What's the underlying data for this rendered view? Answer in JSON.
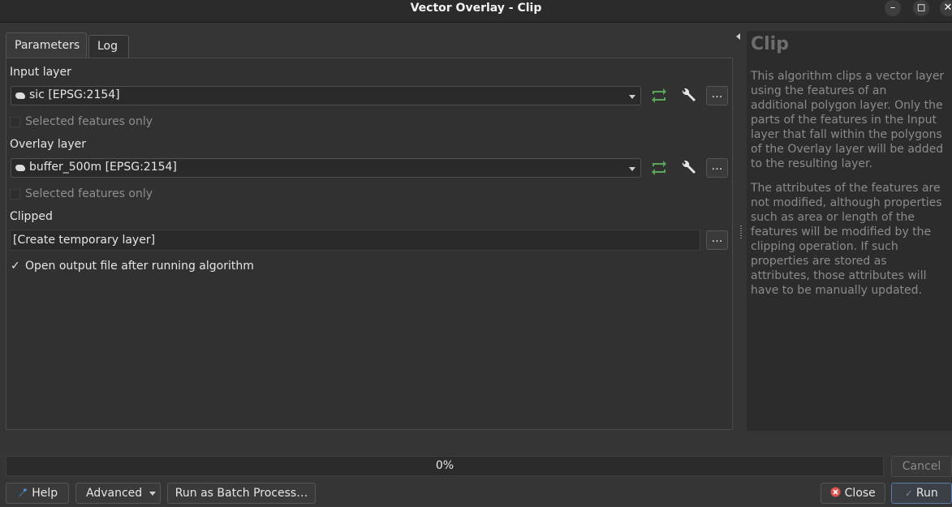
{
  "window": {
    "title": "Vector Overlay - Clip",
    "minimize": "–",
    "maximize": "◻",
    "close": "✕"
  },
  "tabs": [
    {
      "label": "Parameters",
      "active": true
    },
    {
      "label": "Log",
      "active": false
    }
  ],
  "params": {
    "input_layer": {
      "label": "Input layer",
      "value": "sic [EPSG:2154]",
      "selected_only_label": "Selected features only",
      "selected_only_checked": false
    },
    "overlay_layer": {
      "label": "Overlay layer",
      "value": "buffer_500m [EPSG:2154]",
      "selected_only_label": "Selected features only",
      "selected_only_checked": false
    },
    "clipped": {
      "label": "Clipped",
      "value": "[Create temporary layer]"
    },
    "open_output": {
      "label": "Open output file after running algorithm",
      "checked": true
    },
    "more_button": "…"
  },
  "help": {
    "title": "Clip",
    "paragraph1": "This algorithm clips a vector layer using the features of an additional polygon layer. Only the parts of the features in the Input layer that fall within the polygons of the Overlay layer will be added to the resulting layer.",
    "paragraph2": "The attributes of the features are not modified, although properties such as area or length of the features will be modified by the clipping operation. If such properties are stored as attributes, those attributes will have to be manually updated."
  },
  "progress": {
    "text": "0%",
    "value": 0
  },
  "buttons": {
    "cancel": "Cancel",
    "help": "Help",
    "advanced": "Advanced",
    "batch": "Run as Batch Process…",
    "close": "Close",
    "run": "Run"
  },
  "colors": {
    "background": "#353535",
    "refresh_icon": "#5aa55a",
    "close_icon": "#d9534f",
    "help_icon": "#4a8fd8"
  }
}
